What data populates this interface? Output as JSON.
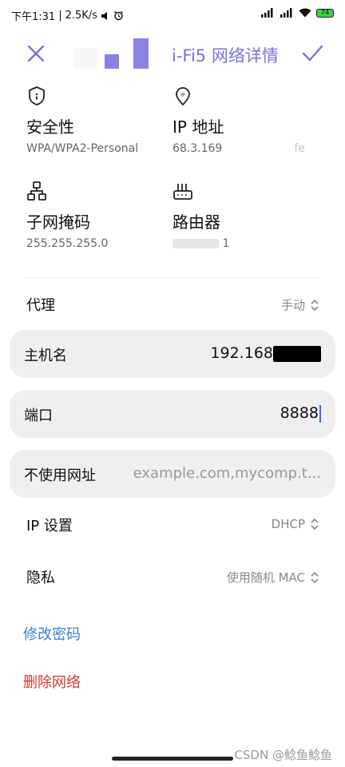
{
  "status_bar": {
    "time": "下午1:31",
    "separator": "|",
    "speed": "2.5K/s",
    "battery": "74"
  },
  "header": {
    "title_visible": "i-Fi5 网络详情"
  },
  "details": {
    "security": {
      "label": "安全性",
      "value": "WPA/WPA2-Personal"
    },
    "ip": {
      "label": "IP 地址",
      "value": "68.3.169",
      "value_extra": "fe"
    },
    "subnet": {
      "label": "子网掩码",
      "value": "255.255.255.0"
    },
    "router": {
      "label": "路由器",
      "value": "1"
    }
  },
  "proxy": {
    "label": "代理",
    "value": "手动"
  },
  "hostname": {
    "label": "主机名",
    "value": "192.168"
  },
  "port": {
    "label": "端口",
    "value": "8888"
  },
  "bypass": {
    "label": "不使用网址",
    "placeholder": "example.com,mycomp.t..."
  },
  "ip_settings": {
    "label": "IP 设置",
    "value": "DHCP"
  },
  "privacy": {
    "label": "隐私",
    "value": "使用随机 MAC"
  },
  "actions": {
    "modify_password": "修改密码",
    "delete_network": "删除网络"
  },
  "watermark": "CSDN @鲶鱼鲶鱼",
  "colors": {
    "accent": "#7b72d9",
    "link_blue": "#3d7fd6",
    "danger_red": "#d13b2e",
    "field_bg": "#efefef"
  }
}
